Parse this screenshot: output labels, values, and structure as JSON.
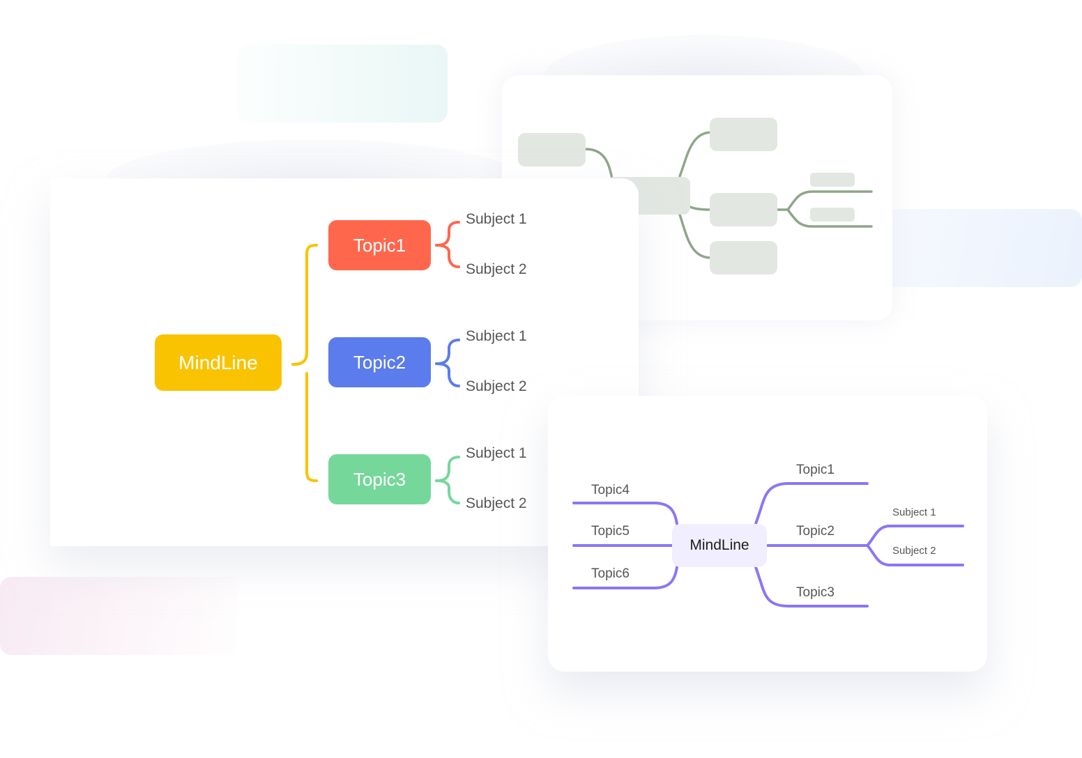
{
  "colors": {
    "root_yellow": "#f9c301",
    "topic1_red": "#ff674d",
    "topic2_blue": "#5b7cec",
    "topic3_green": "#76d79b",
    "ghost_line": "#8ea68a",
    "ghost_node": "#e2e7e2",
    "purple_line": "#8c76f5",
    "purple_root_bg": "#f1efff",
    "text_gray": "#555555"
  },
  "main_map": {
    "root": "MindLine",
    "topics": [
      {
        "label": "Topic1",
        "subjects": [
          "Subject 1",
          "Subject 2"
        ]
      },
      {
        "label": "Topic2",
        "subjects": [
          "Subject 1",
          "Subject 2"
        ]
      },
      {
        "label": "Topic3",
        "subjects": [
          "Subject 1",
          "Subject 2"
        ]
      }
    ]
  },
  "right_map": {
    "root": "MindLine",
    "right_topics": [
      "Topic1",
      "Topic2",
      "Topic3"
    ],
    "left_topics": [
      "Topic4",
      "Topic5",
      "Topic6"
    ],
    "topic2_subjects": [
      "Subject 1",
      "Subject 2"
    ]
  }
}
